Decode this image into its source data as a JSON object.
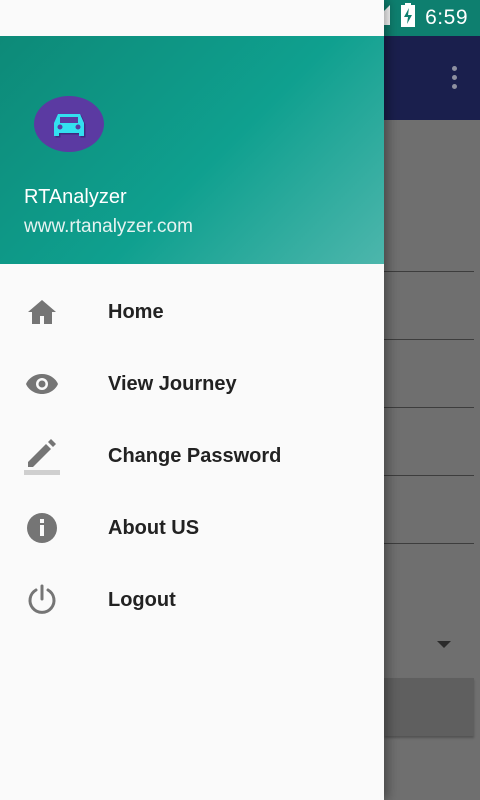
{
  "status_bar": {
    "time": "6:59"
  },
  "drawer": {
    "app_name": "RTAnalyzer",
    "app_url": "www.rtanalyzer.com",
    "items": [
      {
        "label": "Home",
        "icon": "home-icon"
      },
      {
        "label": "View Journey",
        "icon": "eye-icon"
      },
      {
        "label": "Change Password",
        "icon": "pencil-icon"
      },
      {
        "label": "About US",
        "icon": "info-icon"
      },
      {
        "label": "Logout",
        "icon": "power-icon"
      }
    ]
  },
  "colors": {
    "header_start": "#0d8a78",
    "header_end": "#4db6ac",
    "avatar_bg": "#5b3aa2",
    "toolbar_bg": "#1a1f4d"
  }
}
